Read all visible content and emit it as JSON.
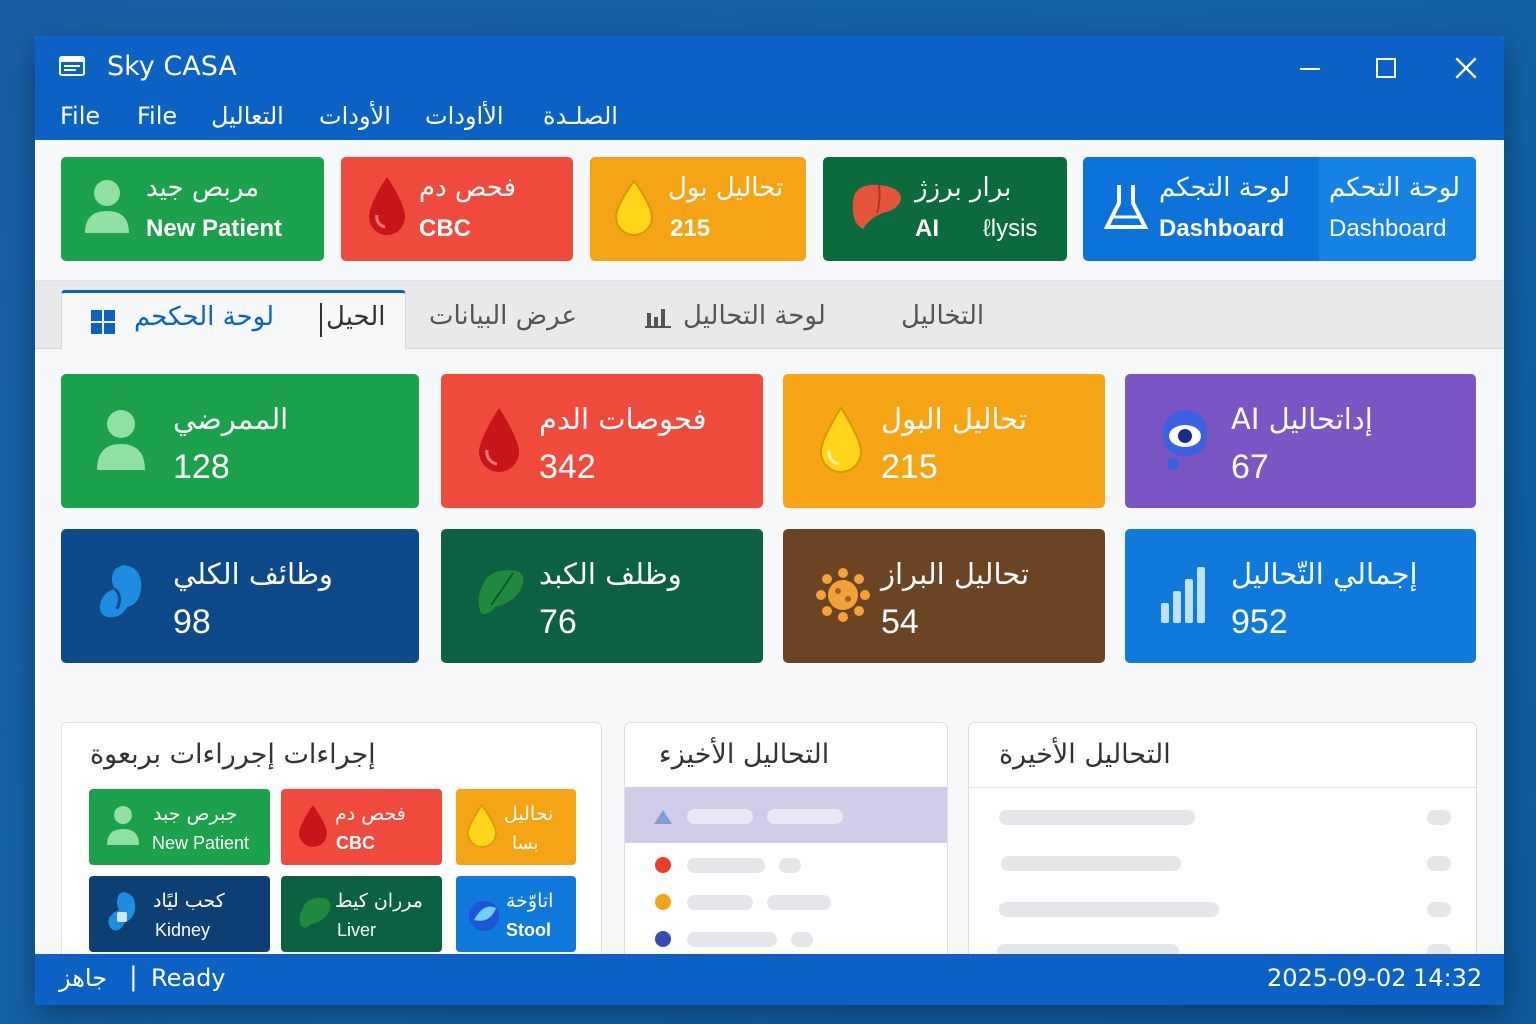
{
  "window": {
    "title": "Sky CASA",
    "icon": "app-window-icon"
  },
  "menu": [
    "File",
    "File",
    "التعاليل",
    "الأودات",
    "الأاودات",
    "الصلـدة"
  ],
  "quick_buttons": [
    {
      "line1": "مربص جيد",
      "line2": "New Patient",
      "color": "#1aa14a",
      "icon": "person-icon"
    },
    {
      "line1": "فحص دم",
      "line2": "CBC",
      "color": "#f04a3c",
      "icon": "blood-drop-icon"
    },
    {
      "line1": "تحاليل بول",
      "line2": "215",
      "color": "#f4a414",
      "icon": "urine-drop-icon"
    },
    {
      "line1": "برار برزژ",
      "line2a": "AI",
      "line2b": "ℓlysis",
      "color": "#0b6b3d",
      "icon": "liver-icon"
    },
    {
      "line1": "لوحة التجكم",
      "line2": "Dashboard",
      "line1b": "لوحة التحكم",
      "line2b": "Dashboard",
      "color": "#0b73d9",
      "icon": "flask-icon"
    }
  ],
  "tabs": [
    {
      "label": "لوحة الحكحم",
      "active": true,
      "icon": "windows-grid-icon"
    },
    {
      "label": "الحيل",
      "active": false
    },
    {
      "label": "عرض البيانات",
      "active": false
    },
    {
      "label": "لوحة التحاليل",
      "active": false,
      "icon": "bar-chart-icon"
    },
    {
      "label": "التخاليل",
      "active": false
    }
  ],
  "stats": [
    {
      "label": "الممرضي",
      "value": "128",
      "color": "#1aa14a",
      "icon": "person-icon"
    },
    {
      "label": "فحوصات الدم",
      "value": "342",
      "color": "#f04a3c",
      "icon": "blood-drop-icon"
    },
    {
      "label": "تحاليل البول",
      "value": "215",
      "color": "#f7a514",
      "icon": "urine-drop-icon"
    },
    {
      "label": "AI إداتحاليل",
      "value": "67",
      "color": "#7b55c4",
      "icon": "ai-eye-icon"
    },
    {
      "label": "وظائف الكلي",
      "value": "98",
      "color": "#0e4a8a",
      "icon": "kidney-icon"
    },
    {
      "label": "وظلف الكبد",
      "value": "76",
      "color": "#0b6141",
      "icon": "liver-icon"
    },
    {
      "label": "تحاليل البراز",
      "value": "54",
      "color": "#6b4424",
      "icon": "germ-icon"
    },
    {
      "label": "إجمالي التّحاليل",
      "value": "952",
      "color": "#0f79dc",
      "icon": "bar-chart-icon"
    }
  ],
  "quick_actions": {
    "title": "إجراءات إجرراءات بربعوة",
    "items": [
      {
        "line1": "جبرص جبد",
        "line2": "New Patient",
        "color": "#1aa14a",
        "icon": "person-icon"
      },
      {
        "line1": "فحص دم",
        "line2": "CBC",
        "color": "#f04a3c",
        "icon": "blood-drop-icon"
      },
      {
        "line1": "نحاليل",
        "line2": "بسا",
        "color": "#f4a414",
        "icon": "urine-drop-icon"
      },
      {
        "line1": "كحب ليًاد",
        "line2": "Kidney",
        "color": "#0e3f74",
        "icon": "kidney-icon"
      },
      {
        "line1": "مرران كيط",
        "line2": "Liver",
        "color": "#0b6141",
        "icon": "liver-icon"
      },
      {
        "line1": "اتاوّخة",
        "line2": "Stool",
        "color": "#0f79dc",
        "icon": "stool-icon"
      }
    ]
  },
  "recent_panel_1": {
    "title": "التحاليل الأخيزء"
  },
  "recent_panel_2": {
    "title": "التحاليل الأخيرة"
  },
  "status": {
    "left_ar": "جاهز",
    "left_en": "Ready",
    "date": "2025-09-02",
    "time": "14:32"
  }
}
